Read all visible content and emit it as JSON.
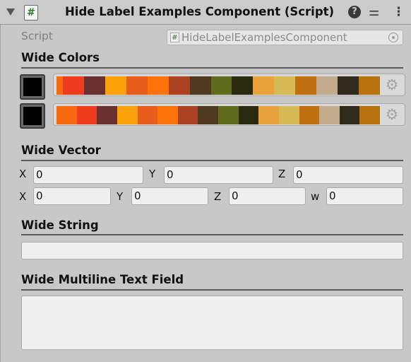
{
  "header": {
    "title": "Hide Label Examples Component (Script)",
    "script_icon_glyph": "#",
    "help_glyph": "?",
    "settings_glyph": "⚌",
    "menu_glyph": "⋮"
  },
  "script_field": {
    "label": "Script",
    "value": "HideLabelExamplesComponent",
    "icon_glyph": "#"
  },
  "wide_colors": {
    "title": "Wide Colors",
    "gear_glyph": "⚙",
    "swatch_color": "#000000",
    "gradients": [
      {
        "colors": [
          "#f76a10",
          "#ef3c1e",
          "#6b3030",
          "#fba10a",
          "#e75d1b",
          "#fd7309",
          "#ad4223",
          "#4f3a21",
          "#5f6c1c",
          "#2a2a0e",
          "#e9a23c",
          "#d5ba55",
          "#c0700e",
          "#c3ab8c",
          "#2f2a1c",
          "#b8730f"
        ]
      },
      {
        "colors": [
          "#f76a10",
          "#ef3c1e",
          "#6b3030",
          "#fba10a",
          "#e75d1b",
          "#fd7309",
          "#ad4223",
          "#4f3a21",
          "#5f6c1c",
          "#2a2a0e",
          "#e9a23c",
          "#d5ba55",
          "#c0700e",
          "#c3ab8c",
          "#2f2a1c",
          "#b8730f"
        ]
      }
    ]
  },
  "wide_vector": {
    "title": "Wide Vector",
    "row1": [
      {
        "axis": "X",
        "value": "0"
      },
      {
        "axis": "Y",
        "value": "0"
      },
      {
        "axis": "Z",
        "value": "0"
      }
    ],
    "row2": [
      {
        "axis": "X",
        "value": "0"
      },
      {
        "axis": "Y",
        "value": "0"
      },
      {
        "axis": "Z",
        "value": "0"
      },
      {
        "axis": "w",
        "value": "0"
      }
    ]
  },
  "wide_string": {
    "title": "Wide String",
    "value": ""
  },
  "wide_multiline": {
    "title": "Wide Multiline Text Field",
    "value": ""
  }
}
